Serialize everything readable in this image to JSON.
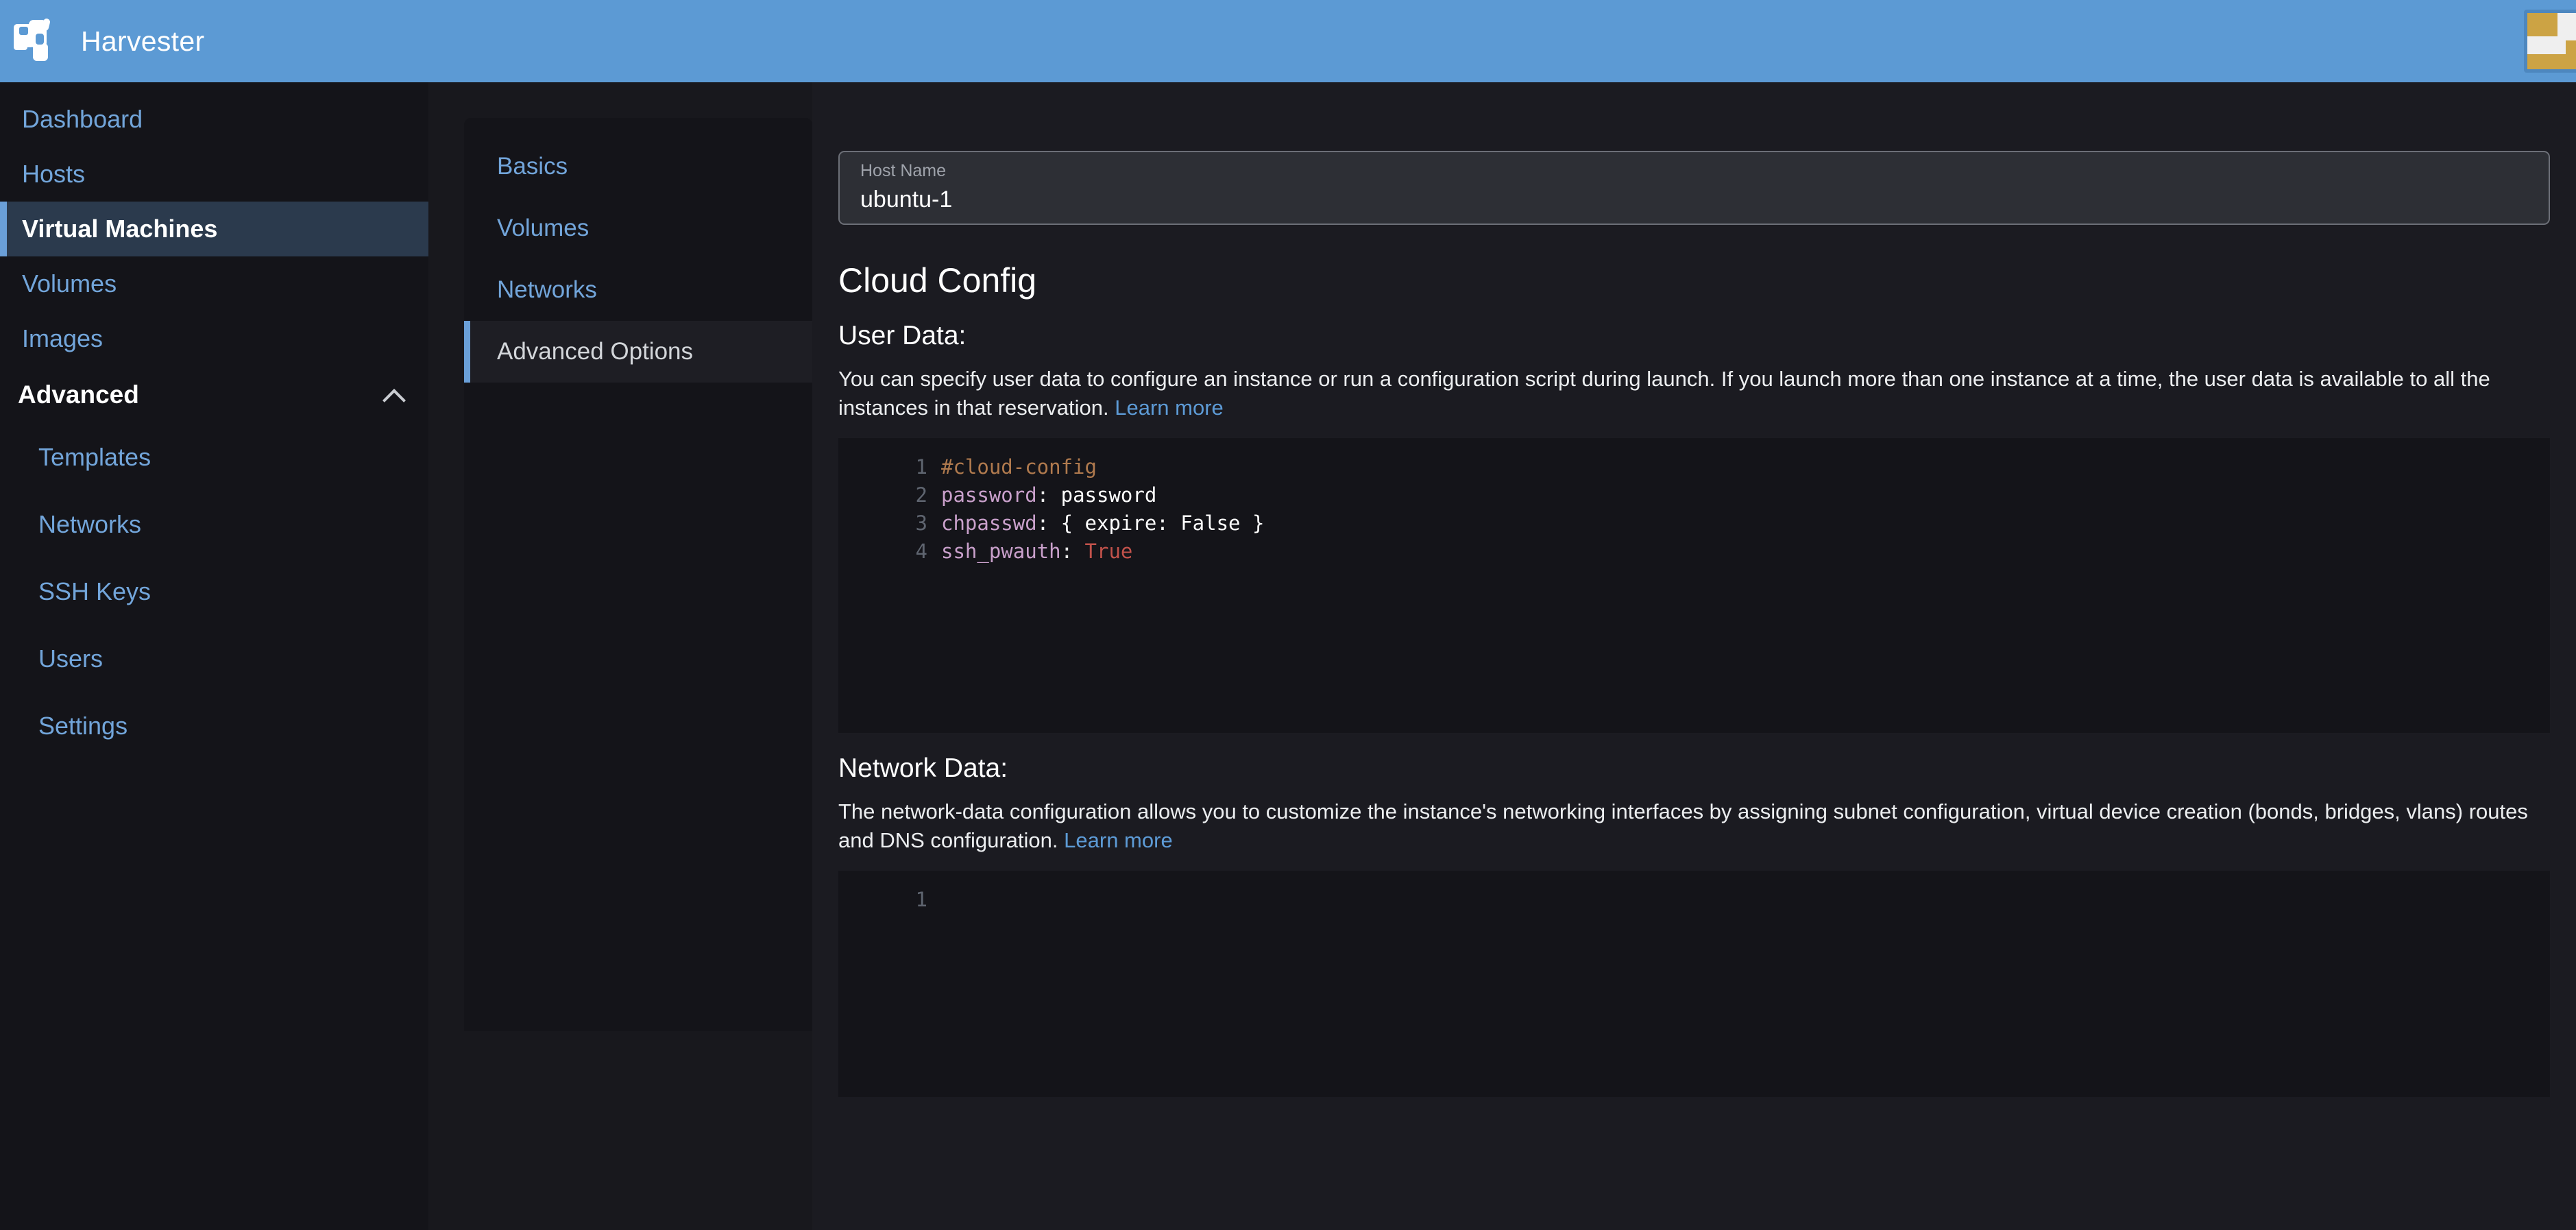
{
  "brand": {
    "name": "Harvester",
    "logo_icon": "harvester-logo-icon"
  },
  "sidebar": {
    "items": [
      {
        "label": "Dashboard",
        "active": false
      },
      {
        "label": "Hosts",
        "active": false
      },
      {
        "label": "Virtual Machines",
        "active": true
      },
      {
        "label": "Volumes",
        "active": false
      },
      {
        "label": "Images",
        "active": false
      }
    ],
    "group": {
      "label": "Advanced",
      "expanded": true,
      "chevron_icon": "chevron-up-icon",
      "items": [
        {
          "label": "Templates"
        },
        {
          "label": "Networks"
        },
        {
          "label": "SSH Keys"
        },
        {
          "label": "Users"
        },
        {
          "label": "Settings"
        }
      ]
    }
  },
  "topbar": {
    "avatar_icon": "user-avatar-icon"
  },
  "tabs": [
    {
      "label": "Basics",
      "active": false
    },
    {
      "label": "Volumes",
      "active": false
    },
    {
      "label": "Networks",
      "active": false
    },
    {
      "label": "Advanced Options",
      "active": true
    }
  ],
  "hostname": {
    "label": "Host Name",
    "value": "ubuntu-1",
    "placeholder": "Host Name"
  },
  "cloud_config": {
    "title": "Cloud Config",
    "user_data": {
      "title": "User Data:",
      "description": "You can specify user data to configure an instance or run a configuration script during launch. If you launch more than one instance at a time, the user data is available to all the instances in that reservation.",
      "learn_more": "Learn more",
      "lines": [
        {
          "n": "1",
          "tokens": [
            {
              "t": "#cloud-config",
              "c": "tok-comment"
            }
          ]
        },
        {
          "n": "2",
          "tokens": [
            {
              "t": "password",
              "c": "tok-key"
            },
            {
              "t": ": ",
              "c": "tok-punct"
            },
            {
              "t": "password",
              "c": "tok-value"
            }
          ]
        },
        {
          "n": "3",
          "tokens": [
            {
              "t": "chpasswd",
              "c": "tok-key"
            },
            {
              "t": ": { expire: False }",
              "c": "tok-value"
            }
          ]
        },
        {
          "n": "4",
          "tokens": [
            {
              "t": "ssh_pwauth",
              "c": "tok-key"
            },
            {
              "t": ": ",
              "c": "tok-punct"
            },
            {
              "t": "True",
              "c": "tok-bool"
            }
          ]
        }
      ]
    },
    "network_data": {
      "title": "Network Data:",
      "description": "The network-data configuration allows you to customize the instance's networking interfaces by assigning subnet configuration, virtual device creation (bonds, bridges, vlans) routes and DNS configuration.",
      "learn_more": "Learn more",
      "lines": [
        {
          "n": "1",
          "tokens": []
        }
      ]
    }
  },
  "colors": {
    "brand_blue": "#5c9ad4",
    "link_blue": "#5d9bd6",
    "nav_link": "#72a5da",
    "active_nav_bg": "#2b3a4d",
    "panel_bg": "#141419",
    "content_bg": "#1b1b21"
  }
}
